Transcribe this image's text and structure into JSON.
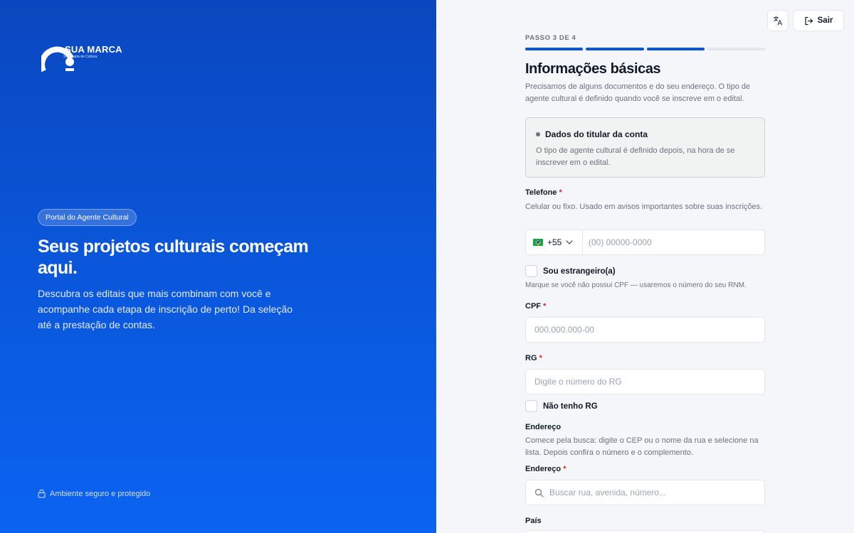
{
  "brand": {
    "name": "SUA MARCA",
    "subtitle": "Secretaria de Cultura"
  },
  "hero": {
    "badge": "Portal do Agente Cultural",
    "title": "Seus projetos culturais começam aqui.",
    "description": "Descubra os editais que mais combinam com você e acompanhe cada etapa de inscrição de perto! Da seleção até a prestação de contas.",
    "security_note": "Ambiente seguro e protegido"
  },
  "header": {
    "translate_icon": "translate-icon",
    "exit_label": "Sair",
    "exit_icon": "logout-icon"
  },
  "form": {
    "step_label": "PASSO 3 DE 4",
    "progress": {
      "current_step": 3,
      "total_steps": 4
    },
    "title": "Informações básicas",
    "subtitle": "Precisamos de alguns documentos e do seu endereço. O tipo de agente cultural é definido quando você se inscreve em o edital.",
    "info_box": {
      "heading": "Dados do titular da conta",
      "text": "O tipo de agente cultural é definido depois, na hora de se inscrever em o edital."
    },
    "phone": {
      "label": "Telefone",
      "required_mark": "*",
      "help": "Celular ou fixo. Usado em avisos importantes sobre suas inscrições.",
      "country_code": "+55",
      "placeholder": "(00) 00000-0000"
    },
    "foreigner": {
      "label": "Sou estrangeiro(a)",
      "checked": false,
      "help": "Marque se você não possui CPF — usaremos o número do seu RNM."
    },
    "cpf": {
      "label": "CPF",
      "required_mark": "*",
      "placeholder": "000.000.000-00"
    },
    "rg": {
      "label": "RG",
      "required_mark": "*",
      "placeholder": "Digite o número do RG"
    },
    "no_rg": {
      "label": "Não tenho RG",
      "checked": false
    },
    "address_section": {
      "title": "Endereço",
      "help": "Comece pela busca: digite o CEP ou o nome da rua e selecione na lista. Depois confira o número e o complemento."
    },
    "address": {
      "label": "Endereço",
      "required_mark": "*",
      "placeholder": "Buscar rua, avenida, número..."
    },
    "country": {
      "label": "País"
    }
  },
  "colors": {
    "primary": "#0a55d8",
    "required": "#dc2626",
    "panel_background": "#f4f6f9"
  }
}
